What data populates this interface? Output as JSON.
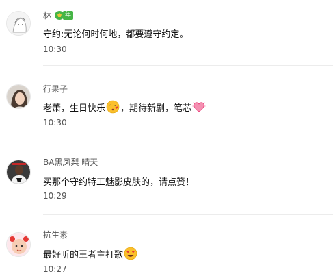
{
  "comments": [
    {
      "author": "林",
      "badge": "年",
      "avatar_icon": "sketch-avatar-icon",
      "content": "守约:无论何时何地，都要遵守约定。",
      "time": "10:30"
    },
    {
      "author": "行果子",
      "avatar_icon": "girl-photo-avatar-icon",
      "content_parts": [
        "老萧，生日快乐",
        "，期待新剧，笔芯"
      ],
      "emojis": [
        "kissing-face-emoji-icon",
        "heart-emoji-icon"
      ],
      "time": "10:30"
    },
    {
      "author": "BA黑凤梨 晴天",
      "avatar_icon": "basketball-player-avatar-icon",
      "content": "买那个守约特工魅影皮肤的，请点赞！",
      "time": "10:29"
    },
    {
      "author": "抗生素",
      "avatar_icon": "baby-photo-avatar-icon",
      "content_parts": [
        "最好听的王者主打歌"
      ],
      "emojis": [
        "heart-eyes-emoji-icon"
      ],
      "time": "10:27"
    }
  ]
}
